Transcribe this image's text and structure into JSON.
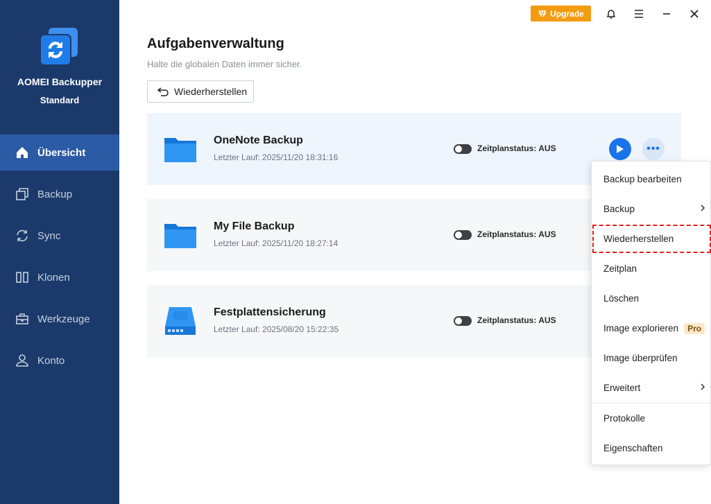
{
  "app": {
    "name": "AOMEI Backupper",
    "edition": "Standard"
  },
  "nav": {
    "items": [
      {
        "label": "Übersicht",
        "icon": "home-icon"
      },
      {
        "label": "Backup",
        "icon": "backup-icon"
      },
      {
        "label": "Sync",
        "icon": "sync-icon"
      },
      {
        "label": "Klonen",
        "icon": "clone-icon"
      },
      {
        "label": "Werkzeuge",
        "icon": "toolbox-icon"
      },
      {
        "label": "Konto",
        "icon": "user-icon"
      }
    ],
    "active": "Übersicht"
  },
  "titlebar": {
    "upgrade_label": "Upgrade"
  },
  "main": {
    "title": "Aufgabenverwaltung",
    "subtitle": "Halte die globalen Daten immer sicher.",
    "restore_button": "Wiederherstellen"
  },
  "tasks": [
    {
      "name": "OneNote Backup",
      "last_run": "Letzter Lauf: 2025/11/20 18:31:16",
      "schedule": "Zeitplanstatus: AUS",
      "icon": "folder-icon"
    },
    {
      "name": "My File Backup",
      "last_run": "Letzter Lauf: 2025/11/20 18:27:14",
      "schedule": "Zeitplanstatus: AUS",
      "icon": "folder-icon"
    },
    {
      "name": "Festplattensicherung",
      "last_run": "Letzter Lauf: 2025/08/20 15:22:35",
      "schedule": "Zeitplanstatus: AUS",
      "icon": "disk-icon"
    }
  ],
  "context_menu": {
    "items": [
      {
        "label": "Backup bearbeiten"
      },
      {
        "label": "Backup",
        "submenu": true
      },
      {
        "label": "Wiederherstellen",
        "highlighted": true
      },
      {
        "label": "Zeitplan"
      },
      {
        "label": "Löschen"
      },
      {
        "label": "Image explorieren",
        "badge": "Pro"
      },
      {
        "label": "Image überprüfen"
      },
      {
        "label": "Erweitert",
        "submenu": true
      },
      {
        "label": "Protokolle"
      },
      {
        "label": "Eigenschaften"
      }
    ]
  },
  "colors": {
    "sidebar_bg": "#1b3a6b",
    "nav_active_bg": "#2c5ba5",
    "accent": "#1a73e8",
    "upgrade": "#f39c12",
    "highlight_border": "#e02020"
  }
}
